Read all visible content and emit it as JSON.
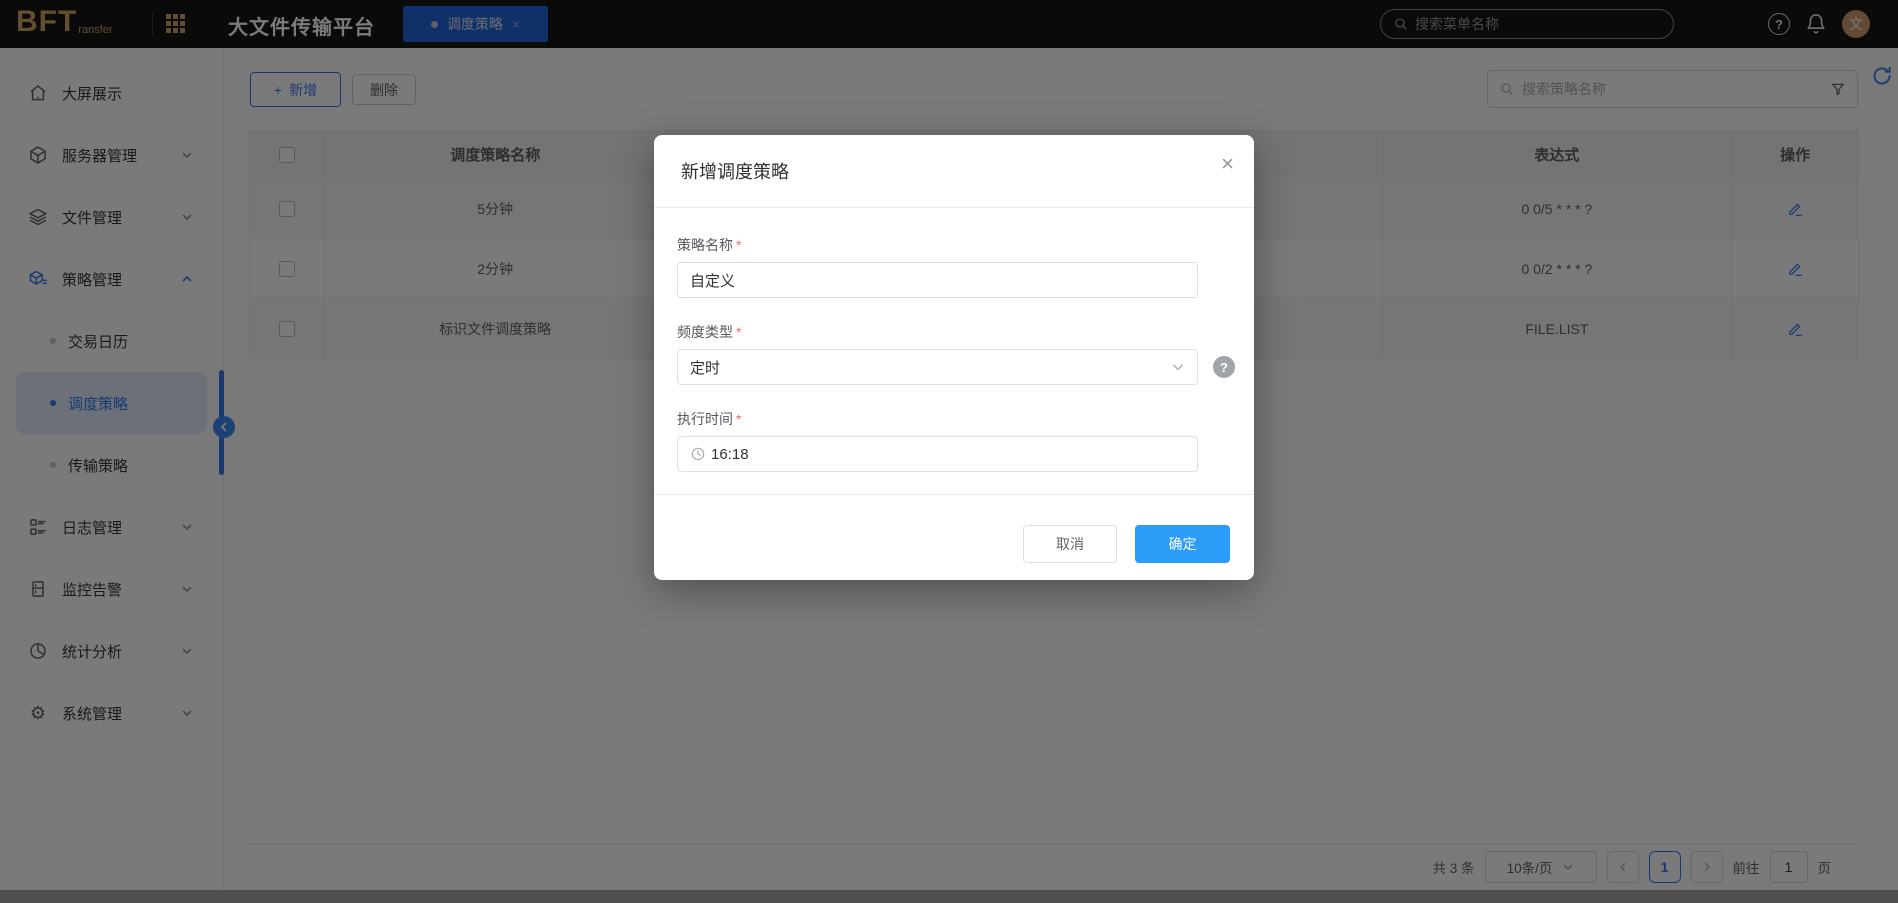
{
  "topbar": {
    "logo": "BFT",
    "logo_sub": "ransfer",
    "app_title": "大文件传输平台",
    "tab": {
      "label": "调度策略",
      "close": "×"
    },
    "search_placeholder": "搜索菜单名称",
    "help_mark": "?",
    "avatar_text": "文"
  },
  "sidebar": {
    "items": [
      {
        "label": "大屏展示"
      },
      {
        "label": "服务器管理"
      },
      {
        "label": "文件管理"
      },
      {
        "label": "策略管理"
      },
      {
        "label": "交易日历"
      },
      {
        "label": "调度策略"
      },
      {
        "label": "传输策略"
      },
      {
        "label": "日志管理"
      },
      {
        "label": "监控告警"
      },
      {
        "label": "统计分析"
      },
      {
        "label": "系统管理"
      }
    ]
  },
  "toolbar": {
    "add_plus": "+",
    "add_label": "新增",
    "delete_label": "删除",
    "search_placeholder": "搜索策略名称"
  },
  "table": {
    "headers": {
      "name": "调度策略名称",
      "expression": "表达式",
      "actions": "操作"
    },
    "rows": [
      {
        "name": "5分钟",
        "expression": "0 0/5 * * * ?"
      },
      {
        "name": "2分钟",
        "expression": "0 0/2 * * * ?"
      },
      {
        "name": "标识文件调度策略",
        "expression": "FILE.LIST"
      }
    ]
  },
  "pagination": {
    "total": "共 3 条",
    "page_size": "10条/页",
    "current_page": "1",
    "goto_label": "前往",
    "goto_value": "1",
    "unit": "页"
  },
  "modal": {
    "title": "新增调度策略",
    "close": "×",
    "required_mark": "*",
    "name_label": "策略名称",
    "name_value": "自定义",
    "freq_label": "频度类型",
    "freq_value": "定时",
    "help_mark": "?",
    "time_label": "执行时间",
    "time_value": "16:18",
    "cancel_label": "取消",
    "confirm_label": "确定"
  },
  "colors": {
    "topbar_bg": "#151515",
    "logo_gold": "#d2a45e",
    "tab_blue": "#2264dd",
    "accent_blue": "#3577f1",
    "confirm_blue": "#2b9cf8",
    "required_red": "#f56c6c",
    "overlay": "rgba(0,0,0,0.52)"
  }
}
